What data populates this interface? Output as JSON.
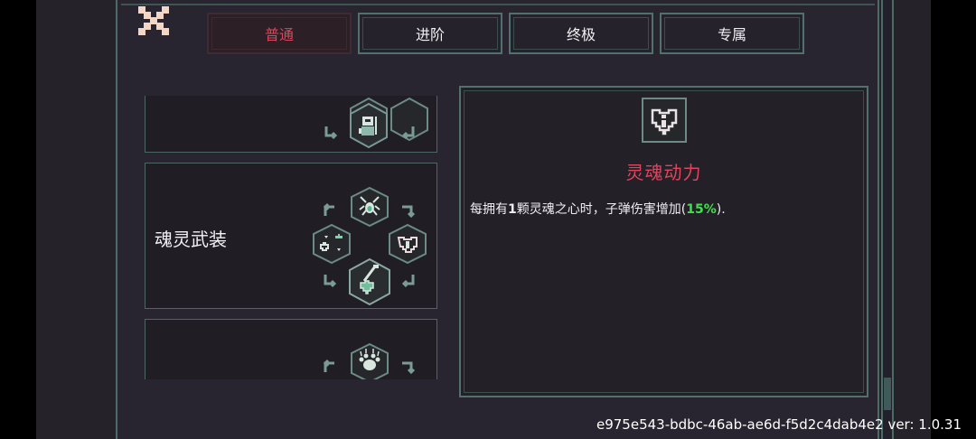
{
  "tabs": [
    {
      "label": "普通",
      "active": true
    },
    {
      "label": "进阶",
      "active": false
    },
    {
      "label": "终极",
      "active": false
    },
    {
      "label": "专属",
      "active": false
    }
  ],
  "cards": [
    {
      "title": ""
    },
    {
      "title": "魂灵武装"
    },
    {
      "title": ""
    }
  ],
  "detail": {
    "icon": "heart-core-icon",
    "title": "灵魂动力",
    "desc_prefix": "每拥有",
    "desc_num": "1",
    "desc_mid": "颗灵魂之心时，子弹伤害增加(",
    "desc_value": "15%",
    "desc_suffix": ")."
  },
  "footer": {
    "version_text": "e975e543-bdbc-46ab-ae6d-f5d2c4dab4e2 ver: 1.0.31"
  },
  "colors": {
    "accent_red": "#e0455d",
    "highlight_green": "#3fe04a",
    "frame_teal": "#52706d"
  }
}
